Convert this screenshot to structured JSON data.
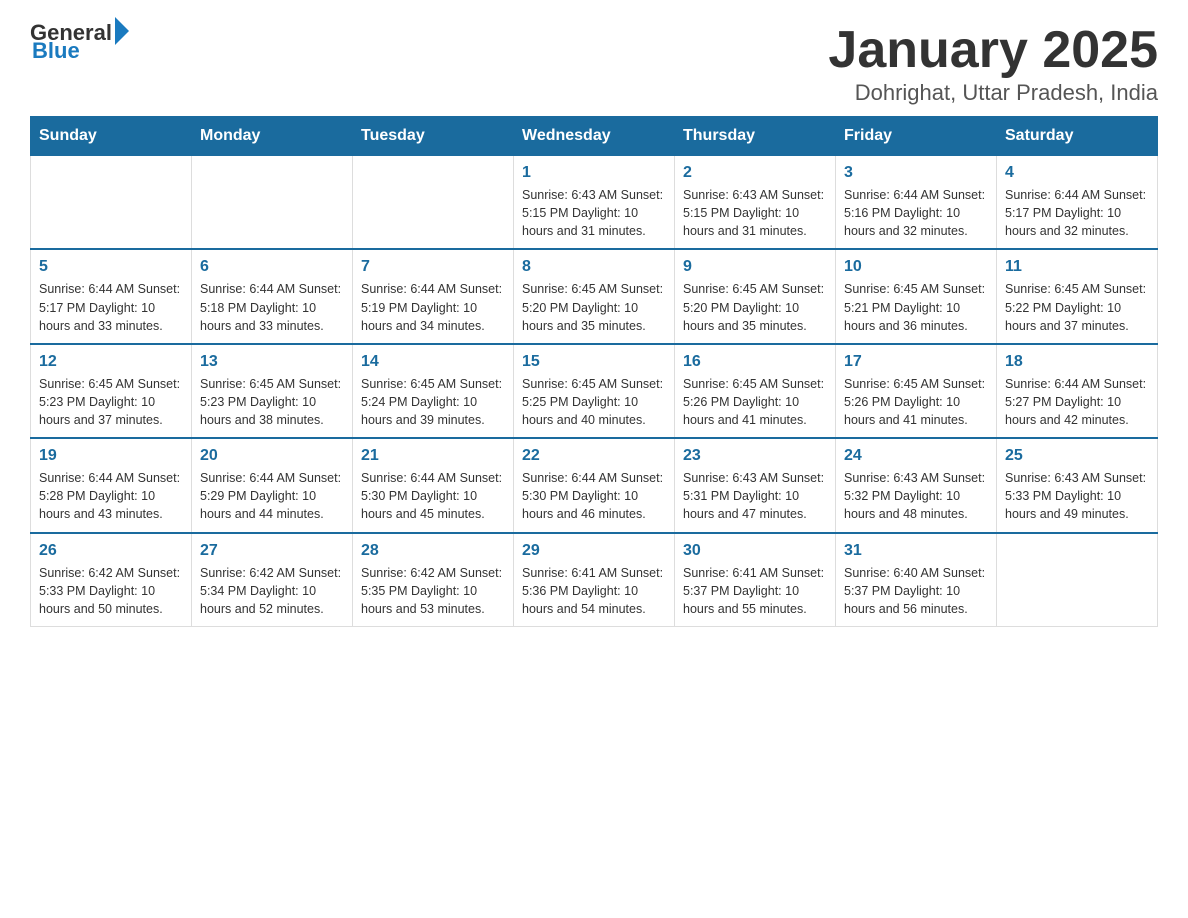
{
  "header": {
    "logo_general": "General",
    "logo_blue": "Blue",
    "main_title": "January 2025",
    "subtitle": "Dohrighat, Uttar Pradesh, India"
  },
  "weekdays": [
    "Sunday",
    "Monday",
    "Tuesday",
    "Wednesday",
    "Thursday",
    "Friday",
    "Saturday"
  ],
  "weeks": [
    [
      {
        "day": "",
        "info": ""
      },
      {
        "day": "",
        "info": ""
      },
      {
        "day": "",
        "info": ""
      },
      {
        "day": "1",
        "info": "Sunrise: 6:43 AM\nSunset: 5:15 PM\nDaylight: 10 hours\nand 31 minutes."
      },
      {
        "day": "2",
        "info": "Sunrise: 6:43 AM\nSunset: 5:15 PM\nDaylight: 10 hours\nand 31 minutes."
      },
      {
        "day": "3",
        "info": "Sunrise: 6:44 AM\nSunset: 5:16 PM\nDaylight: 10 hours\nand 32 minutes."
      },
      {
        "day": "4",
        "info": "Sunrise: 6:44 AM\nSunset: 5:17 PM\nDaylight: 10 hours\nand 32 minutes."
      }
    ],
    [
      {
        "day": "5",
        "info": "Sunrise: 6:44 AM\nSunset: 5:17 PM\nDaylight: 10 hours\nand 33 minutes."
      },
      {
        "day": "6",
        "info": "Sunrise: 6:44 AM\nSunset: 5:18 PM\nDaylight: 10 hours\nand 33 minutes."
      },
      {
        "day": "7",
        "info": "Sunrise: 6:44 AM\nSunset: 5:19 PM\nDaylight: 10 hours\nand 34 minutes."
      },
      {
        "day": "8",
        "info": "Sunrise: 6:45 AM\nSunset: 5:20 PM\nDaylight: 10 hours\nand 35 minutes."
      },
      {
        "day": "9",
        "info": "Sunrise: 6:45 AM\nSunset: 5:20 PM\nDaylight: 10 hours\nand 35 minutes."
      },
      {
        "day": "10",
        "info": "Sunrise: 6:45 AM\nSunset: 5:21 PM\nDaylight: 10 hours\nand 36 minutes."
      },
      {
        "day": "11",
        "info": "Sunrise: 6:45 AM\nSunset: 5:22 PM\nDaylight: 10 hours\nand 37 minutes."
      }
    ],
    [
      {
        "day": "12",
        "info": "Sunrise: 6:45 AM\nSunset: 5:23 PM\nDaylight: 10 hours\nand 37 minutes."
      },
      {
        "day": "13",
        "info": "Sunrise: 6:45 AM\nSunset: 5:23 PM\nDaylight: 10 hours\nand 38 minutes."
      },
      {
        "day": "14",
        "info": "Sunrise: 6:45 AM\nSunset: 5:24 PM\nDaylight: 10 hours\nand 39 minutes."
      },
      {
        "day": "15",
        "info": "Sunrise: 6:45 AM\nSunset: 5:25 PM\nDaylight: 10 hours\nand 40 minutes."
      },
      {
        "day": "16",
        "info": "Sunrise: 6:45 AM\nSunset: 5:26 PM\nDaylight: 10 hours\nand 41 minutes."
      },
      {
        "day": "17",
        "info": "Sunrise: 6:45 AM\nSunset: 5:26 PM\nDaylight: 10 hours\nand 41 minutes."
      },
      {
        "day": "18",
        "info": "Sunrise: 6:44 AM\nSunset: 5:27 PM\nDaylight: 10 hours\nand 42 minutes."
      }
    ],
    [
      {
        "day": "19",
        "info": "Sunrise: 6:44 AM\nSunset: 5:28 PM\nDaylight: 10 hours\nand 43 minutes."
      },
      {
        "day": "20",
        "info": "Sunrise: 6:44 AM\nSunset: 5:29 PM\nDaylight: 10 hours\nand 44 minutes."
      },
      {
        "day": "21",
        "info": "Sunrise: 6:44 AM\nSunset: 5:30 PM\nDaylight: 10 hours\nand 45 minutes."
      },
      {
        "day": "22",
        "info": "Sunrise: 6:44 AM\nSunset: 5:30 PM\nDaylight: 10 hours\nand 46 minutes."
      },
      {
        "day": "23",
        "info": "Sunrise: 6:43 AM\nSunset: 5:31 PM\nDaylight: 10 hours\nand 47 minutes."
      },
      {
        "day": "24",
        "info": "Sunrise: 6:43 AM\nSunset: 5:32 PM\nDaylight: 10 hours\nand 48 minutes."
      },
      {
        "day": "25",
        "info": "Sunrise: 6:43 AM\nSunset: 5:33 PM\nDaylight: 10 hours\nand 49 minutes."
      }
    ],
    [
      {
        "day": "26",
        "info": "Sunrise: 6:42 AM\nSunset: 5:33 PM\nDaylight: 10 hours\nand 50 minutes."
      },
      {
        "day": "27",
        "info": "Sunrise: 6:42 AM\nSunset: 5:34 PM\nDaylight: 10 hours\nand 52 minutes."
      },
      {
        "day": "28",
        "info": "Sunrise: 6:42 AM\nSunset: 5:35 PM\nDaylight: 10 hours\nand 53 minutes."
      },
      {
        "day": "29",
        "info": "Sunrise: 6:41 AM\nSunset: 5:36 PM\nDaylight: 10 hours\nand 54 minutes."
      },
      {
        "day": "30",
        "info": "Sunrise: 6:41 AM\nSunset: 5:37 PM\nDaylight: 10 hours\nand 55 minutes."
      },
      {
        "day": "31",
        "info": "Sunrise: 6:40 AM\nSunset: 5:37 PM\nDaylight: 10 hours\nand 56 minutes."
      },
      {
        "day": "",
        "info": ""
      }
    ]
  ]
}
